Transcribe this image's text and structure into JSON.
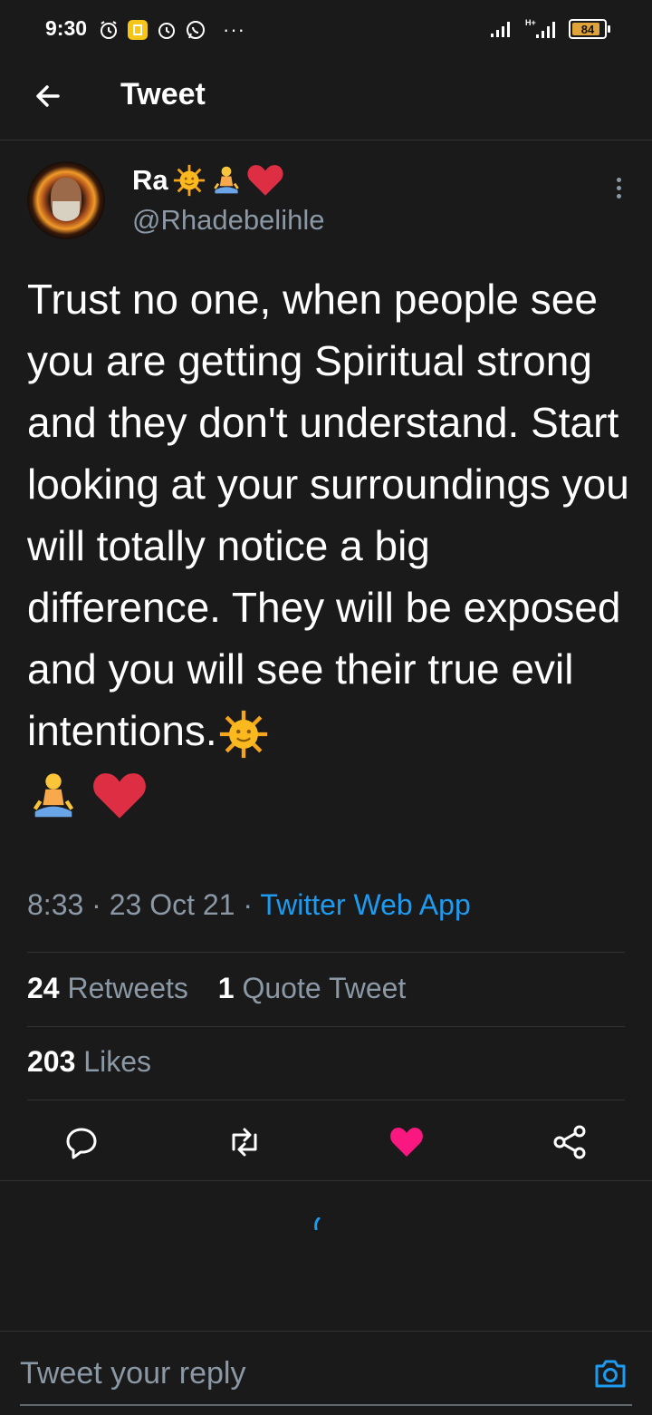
{
  "status_bar": {
    "time": "9:30",
    "battery": "84"
  },
  "header": {
    "title": "Tweet"
  },
  "tweet": {
    "author_name": "Ra",
    "handle": "@Rhadebelihle",
    "text": "Trust no one, when people see you are getting Spiritual strong and they don't understand. Start looking at your surroundings you will totally notice a big difference. They will be exposed and you will see their true evil intentions.",
    "time": "8:33",
    "date": "23 Oct 21",
    "source": "Twitter Web App",
    "retweets_count": "24",
    "retweets_label": "Retweets",
    "quotes_count": "1",
    "quotes_label": "Quote Tweet",
    "likes_count": "203",
    "likes_label": "Likes"
  },
  "reply": {
    "placeholder": "Tweet your reply"
  },
  "colors": {
    "accent": "#1d9bf0",
    "like": "#f91880",
    "background": "#1a1a1a",
    "secondary_text": "#8b98a5"
  },
  "icons": [
    "back-arrow-icon",
    "more-options-icon",
    "reply-icon",
    "retweet-icon",
    "like-icon",
    "share-icon",
    "camera-icon",
    "sun-emoji-icon",
    "meditation-emoji-icon",
    "heart-emoji-icon"
  ]
}
